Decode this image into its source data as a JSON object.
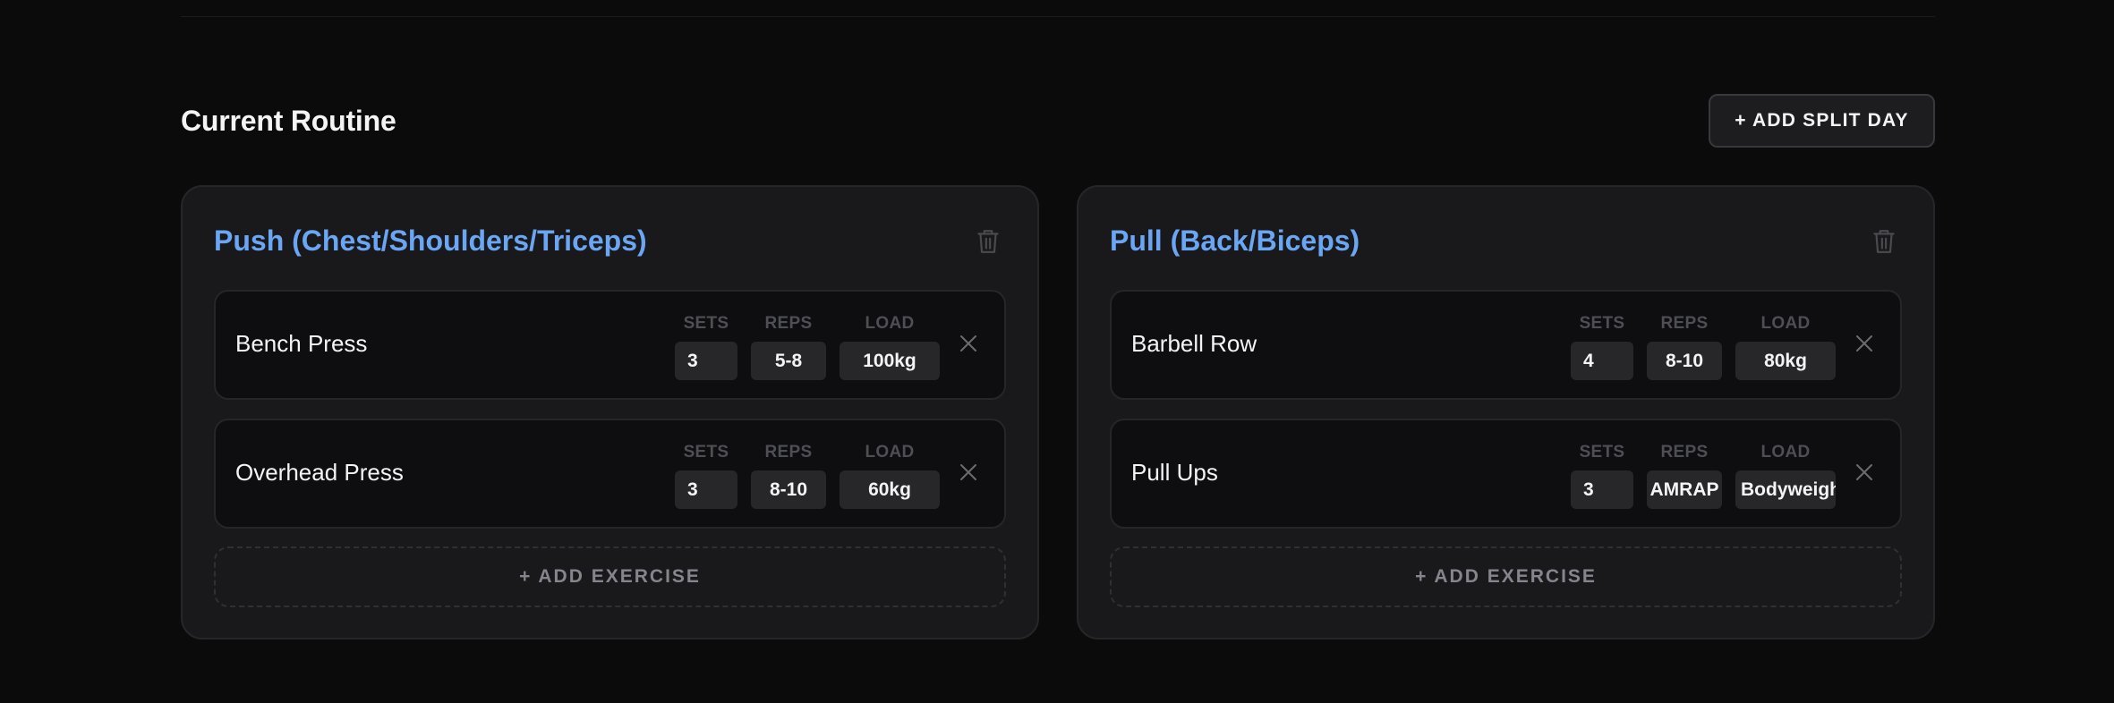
{
  "page": {
    "title": "Current Routine",
    "add_split_label": "+ ADD SPLIT DAY"
  },
  "colors": {
    "accent": "#6aa6f3",
    "background": "#0b0b0c",
    "card": "#19191b",
    "input": "#27272a"
  },
  "field_labels": {
    "sets": "SETS",
    "reps": "REPS",
    "load": "LOAD"
  },
  "splits": [
    {
      "name": "Push (Chest/Shoulders/Triceps)",
      "delete_icon": "trash-icon",
      "exercises": [
        {
          "name": "Bench Press",
          "sets": "3",
          "reps": "5-8",
          "load": "100kg"
        },
        {
          "name": "Overhead Press",
          "sets": "3",
          "reps": "8-10",
          "load": "60kg"
        }
      ],
      "add_exercise_label": "+ ADD EXERCISE"
    },
    {
      "name": "Pull (Back/Biceps)",
      "delete_icon": "trash-icon",
      "exercises": [
        {
          "name": "Barbell Row",
          "sets": "4",
          "reps": "8-10",
          "load": "80kg"
        },
        {
          "name": "Pull Ups",
          "sets": "3",
          "reps": "AMRAP",
          "load": "Bodyweigh"
        }
      ],
      "add_exercise_label": "+ ADD EXERCISE"
    }
  ]
}
